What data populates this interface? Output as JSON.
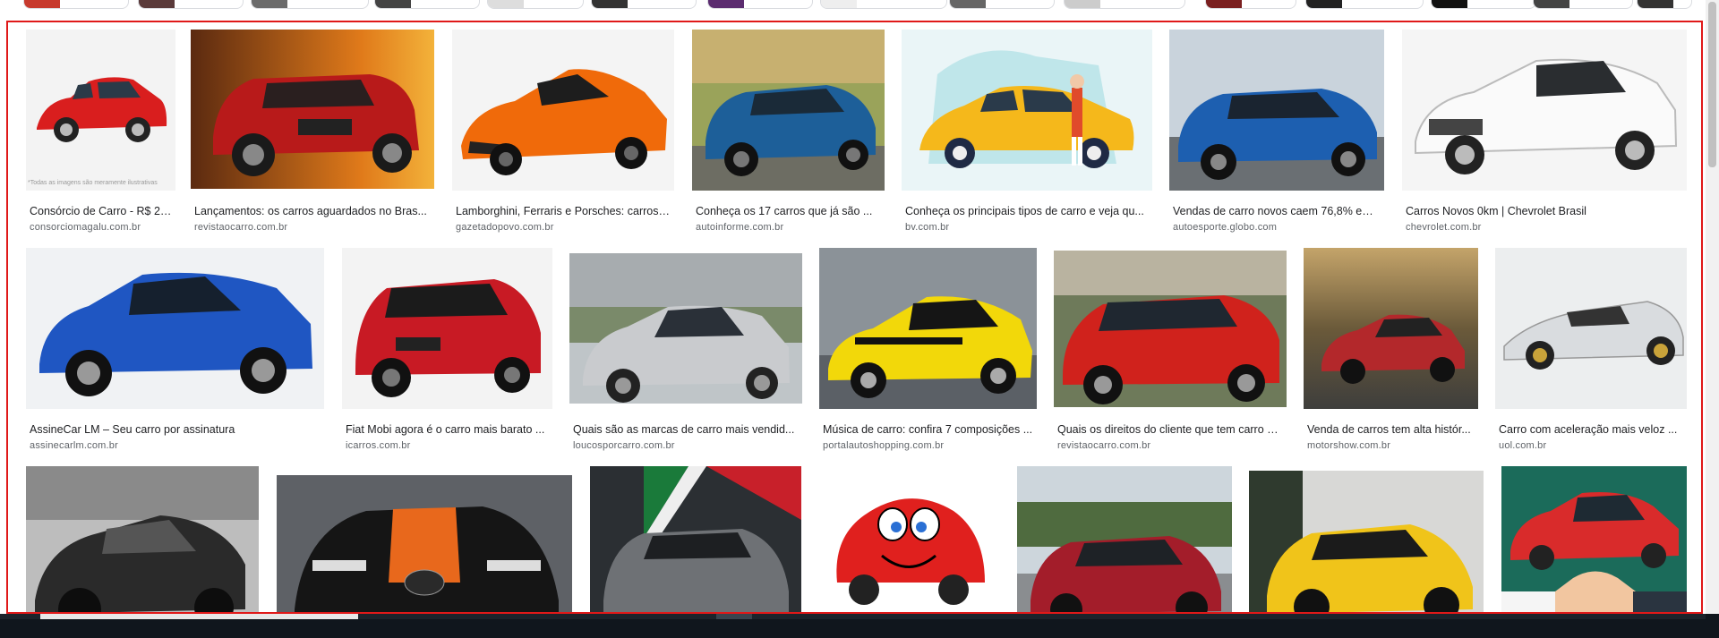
{
  "colors": {
    "frame_border": "#e01919",
    "title_text": "#202124",
    "source_text": "#5f6368"
  },
  "results": [
    {
      "title": "Consórcio de Carro - R$ 25...",
      "source": "consorciomagalu.com.br",
      "icon": "red-hatchback-image",
      "caption": "*Todas as imagens são meramente ilustrativas"
    },
    {
      "title": "Lançamentos: os carros aguardados no Bras...",
      "source": "revistaocarro.com.br",
      "icon": "red-fiat-suv-sunset-image",
      "caption": ""
    },
    {
      "title": "Lamborghini, Ferraris e Porsches: carros ...",
      "source": "gazetadopovo.com.br",
      "icon": "orange-lamborghini-image",
      "caption": ""
    },
    {
      "title": "Conheça os 17 carros que já são ...",
      "source": "autoinforme.com.br",
      "icon": "blue-suv-road-image",
      "caption": ""
    },
    {
      "title": "Conheça os principais tipos de carro e veja qu...",
      "source": "bv.com.br",
      "icon": "yellow-car-illustration-image",
      "caption": ""
    },
    {
      "title": "Vendas de carro novos caem 76,8% em ...",
      "source": "autoesporte.globo.com",
      "icon": "blue-tracker-suv-image",
      "caption": ""
    },
    {
      "title": "Carros Novos 0km | Chevrolet Brasil",
      "source": "chevrolet.com.br",
      "icon": "white-chevrolet-hatch-image",
      "caption": ""
    },
    {
      "title": "AssineCar LM – Seu carro por assinatura",
      "source": "assinecarlm.com.br",
      "icon": "blue-fiat-argo-image",
      "caption": ""
    },
    {
      "title": "Fiat Mobi agora é o carro mais barato ...",
      "source": "icarros.com.br",
      "icon": "red-fiat-mobi-image",
      "caption": ""
    },
    {
      "title": "Quais são as marcas de carro mais vendid...",
      "source": "loucosporcarro.com.br",
      "icon": "silver-onix-city-image",
      "caption": ""
    },
    {
      "title": "Música de carro: confira 7 composições ...",
      "source": "portalautoshopping.com.br",
      "icon": "yellow-camaro-image",
      "caption": ""
    },
    {
      "title": "Quais os direitos do cliente que tem carro d...",
      "source": "revistaocarro.com.br",
      "icon": "red-ecosport-image",
      "caption": ""
    },
    {
      "title": "Venda de carros tem alta histór...",
      "source": "motorshow.com.br",
      "icon": "red-sedan-forest-image",
      "caption": ""
    },
    {
      "title": "Carro com aceleração mais veloz ...",
      "source": "uol.com.br",
      "icon": "silver-hypercar-image",
      "caption": ""
    },
    {
      "title": "",
      "source": "",
      "icon": "black-lykan-supercar-image",
      "caption": ""
    },
    {
      "title": "",
      "source": "",
      "icon": "black-orange-bugatti-image",
      "caption": ""
    },
    {
      "title": "",
      "source": "",
      "icon": "gray-fiat-pulse-image",
      "caption": ""
    },
    {
      "title": "",
      "source": "",
      "icon": "cartoon-red-car-image",
      "caption": ""
    },
    {
      "title": "",
      "source": "",
      "icon": "red-peugeot-suv-image",
      "caption": ""
    },
    {
      "title": "",
      "source": "",
      "icon": "yellow-lamborghini-urus-image",
      "caption": ""
    },
    {
      "title": "",
      "source": "",
      "icon": "red-car-handshake-image",
      "caption": ""
    }
  ]
}
